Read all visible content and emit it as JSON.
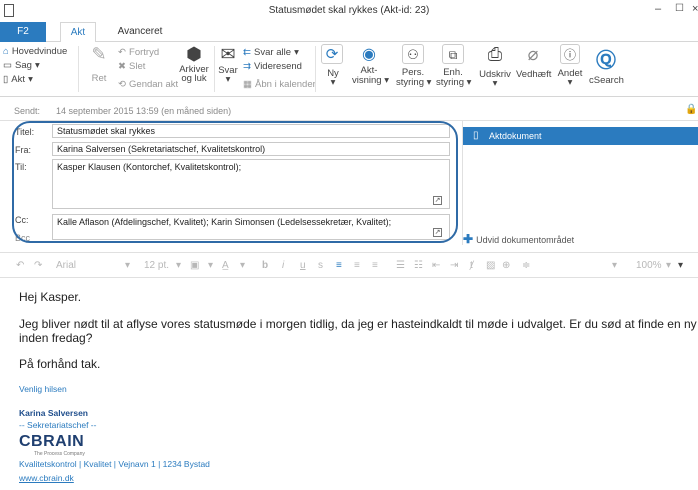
{
  "window": {
    "title": "Statusmødet skal rykkes  (Akt-id: 23)",
    "min_glyph": "–",
    "max_glyph": "☐",
    "close_glyph": "×"
  },
  "tabs": {
    "f2": "F2",
    "akt": "Akt",
    "avanceret": "Avanceret"
  },
  "ribbon": {
    "hovedvindue": "Hovedvindue",
    "sag": "Sag",
    "akt": "Akt",
    "ret": "Ret",
    "fortryd": "Fortryd",
    "slet": "Slet",
    "gendan_akt": "Gendan akt",
    "arkiver_line1": "Arkiver",
    "arkiver_line2": "og luk",
    "svar": "Svar",
    "svar_alle": "Svar alle",
    "videresend": "Videresend",
    "aabn_kalender": "Åbn i kalender",
    "ny": "Ny",
    "akt_visning_1": "Akt-",
    "akt_visning_2": "visning",
    "pers_1": "Pers.",
    "pers_2": "styring",
    "enh_1": "Enh.",
    "enh_2": "styring",
    "udskriv": "Udskriv",
    "vedhaeft": "Vedhæft",
    "andet": "Andet",
    "csearch": "cSearch"
  },
  "sent": {
    "label": "Sendt:",
    "value": "14 september 2015 13:59 (en måned siden)"
  },
  "fields": {
    "titel_label": "Titel:",
    "titel_value": "Statusmødet skal rykkes",
    "fra_label": "Fra:",
    "fra_value": "Karina Salversen (Sekretariatschef, Kvalitetskontrol)",
    "til_label": "Til:",
    "til_value": "Kasper Klausen (Kontorchef, Kvalitetskontrol);",
    "cc_label": "Cc:",
    "cc_value": "Kalle Aflason (Afdelingschef, Kvalitet); Karin Simonsen (Ledelsessekretær, Kvalitet);",
    "bcc_label": "Bcc"
  },
  "docpane": {
    "aktdokument": "Aktdokument",
    "udvid": "Udvid dokumentområdet"
  },
  "format": {
    "font": "Arial",
    "size": "12 pt.",
    "zoom": "100%"
  },
  "body": {
    "greeting": "Hej Kasper.",
    "p1_line1": "Jeg bliver nødt til at aflyse vores statusmøde i morgen tidlig, da jeg er hasteindkaldt til møde i udvalget. Er du sød at finde en ny dag",
    "p1_line2": "inden fredag?",
    "thanks": "På forhånd tak.",
    "regards": "Venlig hilsen",
    "sig_name": "Karina Salversen",
    "sig_title": "-- Sekretariatschef --",
    "logo": "CBRAIN",
    "logo_tag": "The Process Company",
    "address": "Kvalitetskontrol  |  Kvalitet  |  Vejnavn 1  |  1234 Bystad",
    "website": "www.cbrain.dk"
  }
}
